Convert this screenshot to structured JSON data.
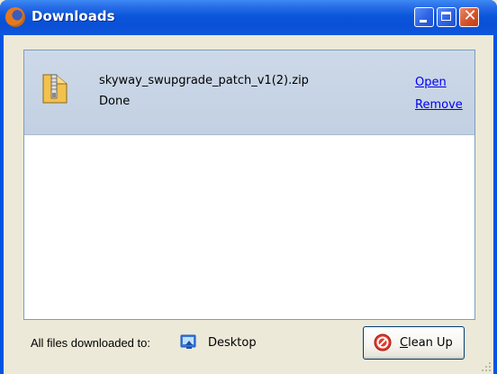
{
  "window": {
    "title": "Downloads"
  },
  "downloads": [
    {
      "file_name": "skyway_swupgrade_patch_v1(2).zip",
      "status": "Done",
      "open_label": "Open",
      "remove_label": "Remove"
    }
  ],
  "footer": {
    "label": "All files downloaded to:",
    "folder": "Desktop",
    "cleanup_mnemonic": "C",
    "cleanup_rest": "lean Up"
  },
  "colors": {
    "titlebar": "#0a50d6",
    "link": "#0000ee",
    "selected_row": "#c7d5e6"
  }
}
